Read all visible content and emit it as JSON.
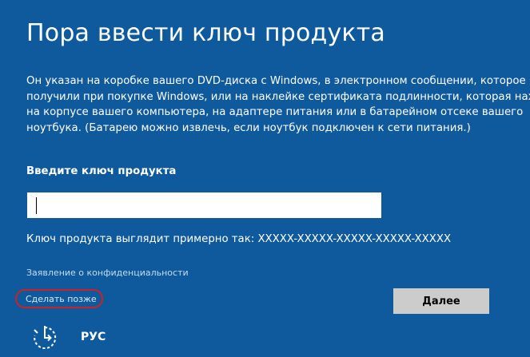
{
  "page": {
    "title": "Пора ввести ключ продукта",
    "description": "Он указан на коробке вашего DVD-диска с Windows, в электронном сообщении, которое вы\nполучили при покупке Windows, или на наклейке сертификата подлинности, которая находится\nна корпусе вашего компьютера, на адаптере питания или в батарейном отсеке вашего\nноутбука. (Батарею можно извлечь, если ноутбук подключен к сети питания.)"
  },
  "form": {
    "key_label": "Введите ключ продукта",
    "key_value": "",
    "example_text": "Ключ продукта выглядит примерно так: XXXXX-XXXXX-XXXXX-XXXXX-XXXXX"
  },
  "links": {
    "privacy": "Заявление о конфиденциальности",
    "later": "Сделать позже"
  },
  "buttons": {
    "next": "Далее"
  },
  "footer": {
    "accessibility_icon": "ease-of-access-icon",
    "language": "РУС"
  },
  "colors": {
    "background": "#0f5a9c",
    "button": "#cccccc",
    "highlight": "#d21f1f"
  }
}
